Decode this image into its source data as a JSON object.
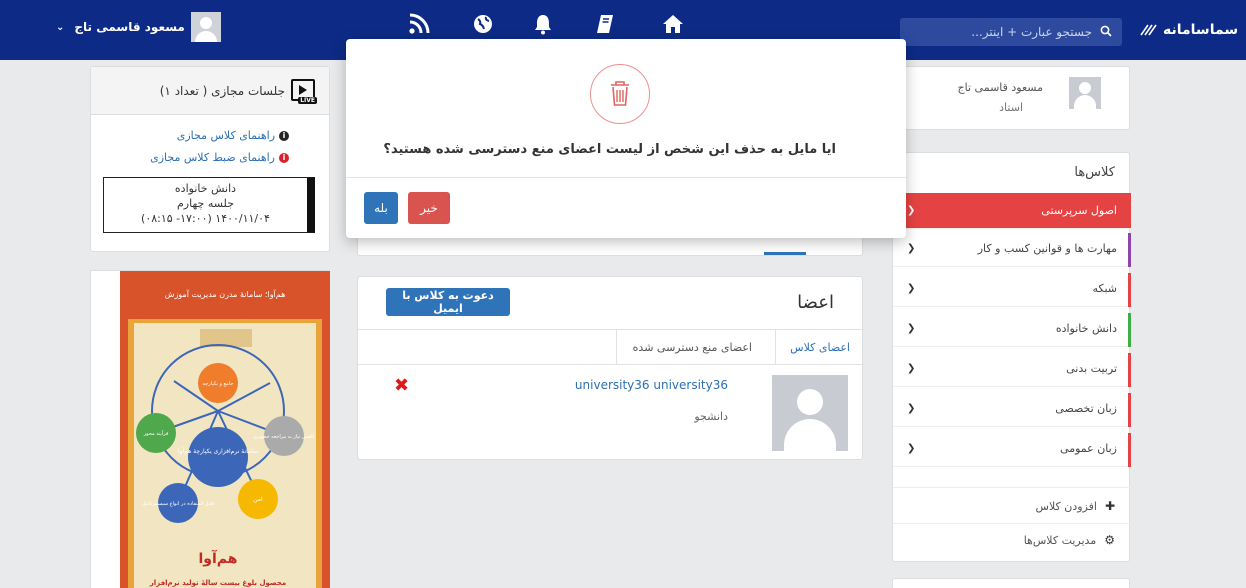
{
  "topbar": {
    "user_name": "مسعود قاسمی تاج",
    "user_caret": "⌄",
    "search_placeholder": "جستجو عبارت + اینتر...",
    "logo_text": "سماسامانه"
  },
  "profile": {
    "name": "مسعود قاسمی تاج",
    "role": "استاد"
  },
  "classes": {
    "title": "کلاس‌ها",
    "items": [
      {
        "label": "اصول سرپرستی",
        "color": "#e54343",
        "active": true
      },
      {
        "label": "مهارت ها و قوانین کسب و کار",
        "color": "#8e44ad"
      },
      {
        "label": "شبکه",
        "color": "#e54343"
      },
      {
        "label": "دانش خانواده",
        "color": "#3fae49"
      },
      {
        "label": "تربیت بدنی",
        "color": "#e54343"
      },
      {
        "label": "زبان تخصصی",
        "color": "#e54343"
      },
      {
        "label": "زبان عمومی",
        "color": "#e54343"
      }
    ],
    "add_label": "افزودن کلاس",
    "manage_label": "مدیریت کلاس‌ها"
  },
  "virtual": {
    "title": "جلسات مجازی ( تعداد ۱)",
    "live_badge": "LIVE",
    "guide_label": "راهنمای کلاس مجازی",
    "record_label": "راهنمای ضبط کلاس مجازی",
    "session": {
      "course": "دانش خانواده",
      "session_name": "جلسه چهارم",
      "datetime": "۱۴۰۰/۱۱/۰۴ (۱۷:۰۰- ۰۸:۱۵)"
    }
  },
  "poster": {
    "header": "هم‌آوا؛ سامانهٔ مدرن مدیریت آموزش",
    "center": "سامانهٔ نرم‌افزاری یکپارچهٔ هم‌آوا",
    "node1": "جامع و یکپارچه",
    "node2": "کاهش نیاز به مراجعه حضوری",
    "node3": "امن",
    "node4": "قابل استفاده در انواع سیستم‌عامل",
    "node5": "فرآیند محور",
    "brand": "هم‌آوا",
    "tagline": "محصول بلوغ بیست سالهٔ تولید نرم‌افزار"
  },
  "members": {
    "title": "اعضا",
    "invite_label": "دعوت به کلاس با ایمیل",
    "tab_members": "اعضای کلاس",
    "tab_banned": "اعضای منع دسترسی شده",
    "row": {
      "name": "university36 university36",
      "role": "دانشجو",
      "delete_glyph": "✖"
    }
  },
  "modal": {
    "question": "ایا مایل به حذف این شخص از لیست اعضای منع دسترسی شده هستید؟",
    "yes_label": "بله",
    "no_label": "خیر"
  }
}
